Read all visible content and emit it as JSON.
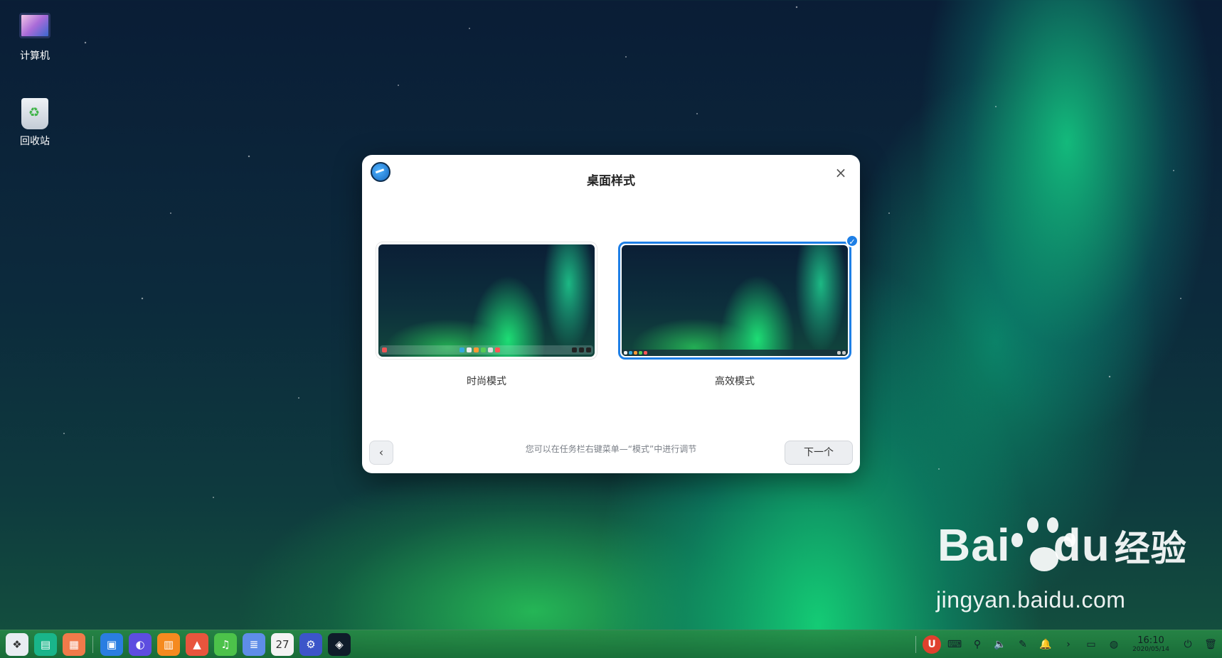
{
  "desktop": {
    "icons": [
      {
        "label": "计算机",
        "icon": "computer-icon"
      },
      {
        "label": "回收站",
        "icon": "trash-icon"
      }
    ]
  },
  "dialog": {
    "title": "桌面样式",
    "options": [
      {
        "label": "时尚模式",
        "selected": false
      },
      {
        "label": "高效模式",
        "selected": true
      }
    ],
    "hint": "您可以在任务栏右键菜单—“模式”中进行调节",
    "next_label": "下一个",
    "back_glyph": "‹",
    "close_glyph": "×",
    "check_glyph": "✓",
    "accent_color": "#1e7fe6"
  },
  "taskbar": {
    "apps": [
      {
        "name": "launcher-icon",
        "glyph": "❖",
        "color": "#e9edf2"
      },
      {
        "name": "multitask-view-icon",
        "glyph": "▤",
        "color": "#19b58a"
      },
      {
        "name": "workspace-icon",
        "glyph": "▦",
        "color": "#f07a4a"
      },
      {
        "name": "file-manager-icon",
        "glyph": "▣",
        "color": "#2a7de1"
      },
      {
        "name": "browser-icon",
        "glyph": "◐",
        "color": "#5d4de0"
      },
      {
        "name": "app-store-icon",
        "glyph": "▥",
        "color": "#f58a1f"
      },
      {
        "name": "image-viewer-icon",
        "glyph": "▲",
        "color": "#e8553d"
      },
      {
        "name": "music-icon",
        "glyph": "♫",
        "color": "#4cc24a"
      },
      {
        "name": "document-viewer-icon",
        "glyph": "≣",
        "color": "#5e8de8"
      },
      {
        "name": "calendar-icon",
        "glyph": "27",
        "color": "#f3f3f3"
      },
      {
        "name": "settings-icon",
        "glyph": "⚙",
        "color": "#3c55c9"
      },
      {
        "name": "welcome-app-icon",
        "glyph": "◈",
        "color": "#0f1c2a"
      }
    ],
    "tray": [
      {
        "name": "antivirus-icon",
        "glyph": "U"
      },
      {
        "name": "keyboard-icon",
        "glyph": "⌨"
      },
      {
        "name": "usb-icon",
        "glyph": "⚲"
      },
      {
        "name": "volume-icon",
        "glyph": "🔈"
      },
      {
        "name": "pen-icon",
        "glyph": "✎"
      },
      {
        "name": "notification-icon",
        "glyph": "🔔"
      },
      {
        "name": "chevron-right-icon",
        "glyph": "›"
      },
      {
        "name": "input-method-icon",
        "glyph": "▭"
      },
      {
        "name": "network-icon",
        "glyph": "◍"
      }
    ],
    "clock_time": "16:10",
    "clock_date": "2020/05/14",
    "power_glyph": "⏻",
    "trash_glyph": "🗑"
  },
  "watermark": {
    "brand_left": "Bai",
    "brand_right": "du",
    "brand_cn": "经验",
    "url": "jingyan.baidu.com"
  }
}
